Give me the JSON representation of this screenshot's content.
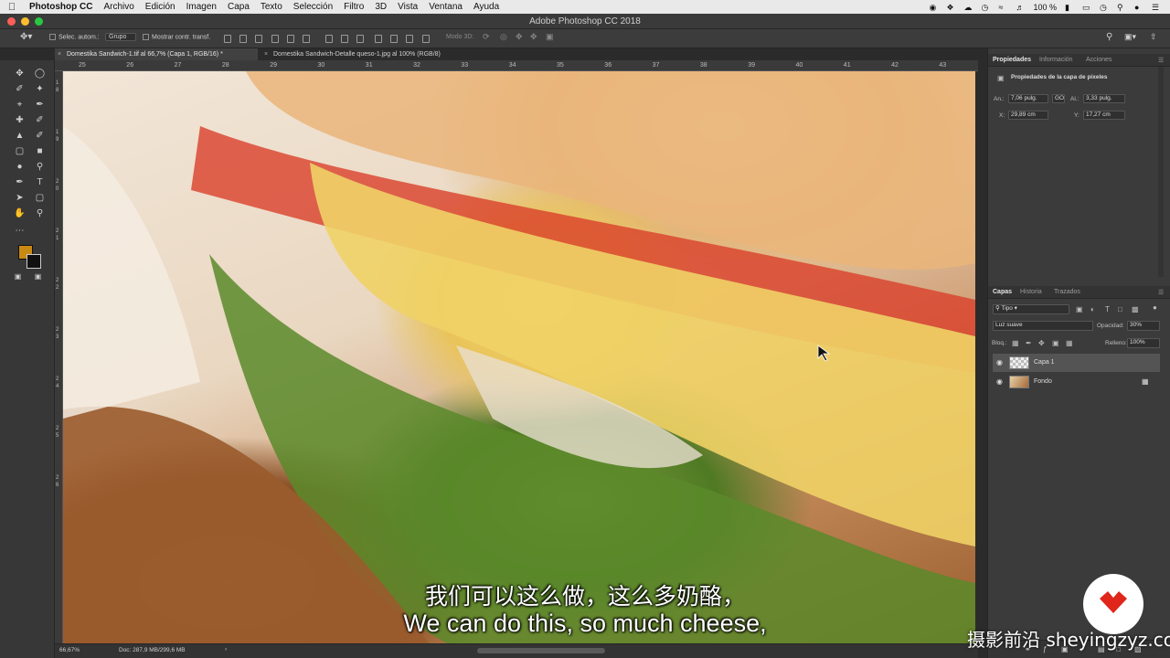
{
  "menubar": {
    "app_name": "Photoshop CC",
    "items": [
      "Archivo",
      "Edición",
      "Imagen",
      "Capa",
      "Texto",
      "Selección",
      "Filtro",
      "3D",
      "Vista",
      "Ventana",
      "Ayuda"
    ],
    "battery": "100 %"
  },
  "window": {
    "title": "Adobe Photoshop CC 2018"
  },
  "options": {
    "auto_select_label": "Selec. autom.:",
    "auto_select_value": "Grupo",
    "show_transform_label": "Mostrar contr. transf.",
    "mode_3d_label": "Modo 3D:"
  },
  "tabs": [
    {
      "label": "Domestika Sandwich-1.tif al 66,7% (Capa 1, RGB/16) *"
    },
    {
      "label": "Domestika Sandwich-Detalle queso-1.jpg al 100% (RGB/8)"
    }
  ],
  "ruler": {
    "top": [
      "25",
      "26",
      "27",
      "28",
      "29",
      "30",
      "31",
      "32",
      "33",
      "34",
      "35",
      "36",
      "37",
      "38",
      "39",
      "40",
      "41",
      "42",
      "43"
    ],
    "left": [
      "1",
      "8",
      "1",
      "9",
      "2",
      "0",
      "2",
      "1",
      "2",
      "2",
      "2",
      "3",
      "2",
      "4",
      "2",
      "5",
      "2",
      "6"
    ]
  },
  "properties": {
    "tabs": [
      "Propiedades",
      "Información",
      "Acciones"
    ],
    "header": "Propiedades de la capa de píxeles",
    "w_label": "An.:",
    "w_value": "7,06 pulg.",
    "link": "GO",
    "h_label": "Al.:",
    "h_value": "3,33 pulg.",
    "x_label": "X:",
    "x_value": "29,89 cm",
    "y_label": "Y:",
    "y_value": "17,27 cm"
  },
  "layers_panel": {
    "tabs": [
      "Capas",
      "Historia",
      "Trazados"
    ],
    "filter_kind": "Tipo",
    "blend_mode": "Luz suave",
    "opacity_label": "Opacidad:",
    "opacity_value": "30%",
    "lock_label": "Bloq.:",
    "fill_label": "Relleno:",
    "fill_value": "100%",
    "layers": [
      {
        "name": "Capa 1"
      },
      {
        "name": "Fondo"
      }
    ]
  },
  "status": {
    "zoom": "66,67%",
    "doc": "Doc: 287,9 MB/299,6 MB"
  },
  "subtitles": {
    "cn": "我们可以这么做，这么多奶酪，",
    "en": "We can do this, so much cheese,"
  },
  "watermark": "摄影前沿 sheyingzyz.com",
  "colors": {
    "foreground": "#c98a14",
    "background": "#111111",
    "accent_logo": "#e0251b"
  }
}
